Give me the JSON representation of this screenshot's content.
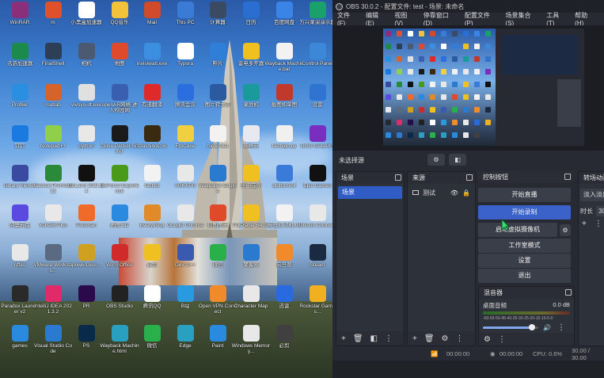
{
  "desktop_icons": [
    {
      "label": "WinRAR",
      "icon": "winrar-icon",
      "color": "#8b2f7a"
    },
    {
      "label": "m",
      "icon": "m-app-icon",
      "color": "#e0502a"
    },
    {
      "label": "小黑盒加速器",
      "icon": "xiaoheihe-icon",
      "color": "#ffffff"
    },
    {
      "label": "QQ音乐",
      "icon": "qqmusic-icon",
      "color": "#f2c23a"
    },
    {
      "label": "Mail",
      "icon": "mail-icon",
      "color": "#d04a2c"
    },
    {
      "label": "This PC",
      "icon": "this-pc-icon",
      "color": "#3a7bd5"
    },
    {
      "label": "计算器",
      "icon": "calculator-icon",
      "color": "#3b4a63"
    },
    {
      "label": "日历",
      "icon": "calendar-icon",
      "color": "#2b6ed2"
    },
    {
      "label": "百度网盘",
      "icon": "baidu-netdisk-icon",
      "color": "#3a84e8"
    },
    {
      "label": "万兴录演演示器",
      "icon": "wondershare-recorder-icon",
      "color": "#1aa06a"
    },
    {
      "label": "迅游加速器",
      "icon": "xunyou-icon",
      "color": "#1c8a4a"
    },
    {
      "label": "FinalShell",
      "icon": "finalshell-icon",
      "color": "#2d3e57"
    },
    {
      "label": "相机",
      "icon": "camera-icon",
      "color": "#4b5a70"
    },
    {
      "label": "地图",
      "icon": "maps-icon",
      "color": "#e04a2c"
    },
    {
      "label": "invisiwatt.exe",
      "icon": "invisiwatt-icon",
      "color": "#3b8ee0"
    },
    {
      "label": "Typora",
      "icon": "typora-icon",
      "color": "#ffffff"
    },
    {
      "label": "照片",
      "icon": "photos-icon",
      "color": "#2f7fd8"
    },
    {
      "label": "雷电多开器",
      "icon": "ldplayer-multi-icon",
      "color": "#f0c020"
    },
    {
      "label": "Wayback Machine.bat",
      "icon": "batch-file-icon",
      "color": "#f2f2f2"
    },
    {
      "label": "Control Panel",
      "icon": "control-panel-icon",
      "color": "#3c87d8"
    },
    {
      "label": "Profiler",
      "icon": "profiler-icon",
      "color": "#2a8fe0"
    },
    {
      "label": "matlab",
      "icon": "matlab-icon",
      "color": "#d6642a"
    },
    {
      "label": "vivoyo-dt.exe",
      "icon": "exe-file-icon",
      "color": "#e0e0e0"
    },
    {
      "label": "openAR网络 进入校园网",
      "icon": "openar-icon",
      "color": "#3a5fb0"
    },
    {
      "label": "有道翻译",
      "icon": "youdao-icon",
      "color": "#e02a2a"
    },
    {
      "label": "腾讯会议",
      "icon": "tencent-meeting-icon",
      "color": "#2a6ee0"
    },
    {
      "label": "图片转文字",
      "icon": "ocr-icon",
      "color": "#2c5aa0"
    },
    {
      "label": "录屏机",
      "icon": "screen-recorder-icon",
      "color": "#1a9a9a"
    },
    {
      "label": "截图和草图",
      "icon": "snip-sketch-icon",
      "color": "#c0392b"
    },
    {
      "label": "设置",
      "icon": "settings-gear-icon",
      "color": "#2f74d0"
    },
    {
      "label": "钉钉",
      "icon": "dingtalk-icon",
      "color": "#1a7ae0"
    },
    {
      "label": "Notepad++",
      "icon": "notepadpp-icon",
      "color": "#8fcf4a"
    },
    {
      "label": "python",
      "icon": "python-icon",
      "color": "#e8e8e8"
    },
    {
      "label": "Clone Packet Sniffer",
      "icon": "packet-sniffer-icon",
      "color": "#1a1a1a"
    },
    {
      "label": "ClashingCon",
      "icon": "clashingcon-icon",
      "color": "#3a2a10"
    },
    {
      "label": "FtpCaxe",
      "icon": "ftp-icon",
      "color": "#f0d040"
    },
    {
      "label": "meter.bat",
      "icon": "batch-file-icon",
      "color": "#f2f2f2"
    },
    {
      "label": "网络云",
      "icon": "cloud-app-icon",
      "color": "#e8e8f0"
    },
    {
      "label": "filethigh.py",
      "icon": "python-file-icon",
      "color": "#f0f0f0"
    },
    {
      "label": "GOG GALAXY",
      "icon": "gog-galaxy-icon",
      "color": "#7a2ec0"
    },
    {
      "label": "Binary Viewer",
      "icon": "binary-viewer-icon",
      "color": "#3a4aa0"
    },
    {
      "label": "Navicat Premium 12",
      "icon": "navicat-icon",
      "color": "#2a8a3a"
    },
    {
      "label": "GoLand 2021.3.4",
      "icon": "goland-icon",
      "color": "#111111"
    },
    {
      "label": "GeForce Experience",
      "icon": "geforce-icon",
      "color": "#4a9a1a"
    },
    {
      "label": "fastlist",
      "icon": "file-icon",
      "color": "#f2f2f2"
    },
    {
      "label": "ARKAPR",
      "icon": "arkapr-icon",
      "color": "#e8e8e8"
    },
    {
      "label": "Wallpaper Engine",
      "icon": "wallpaper-engine-icon",
      "color": "#2a7ad0"
    },
    {
      "label": "出门在外",
      "icon": "travel-icon",
      "color": "#f0c020"
    },
    {
      "label": "qbittorrent",
      "icon": "qbittorrent-icon",
      "color": "#3a7ad8"
    },
    {
      "label": "Epic Games",
      "icon": "epic-games-icon",
      "color": "#111111"
    },
    {
      "label": "阿里云盘",
      "icon": "aliyun-drive-icon",
      "color": "#5a4ae0"
    },
    {
      "label": "Xshell8 Plus",
      "icon": "xshell-icon",
      "color": "#e8e8e8"
    },
    {
      "label": "Postman",
      "icon": "postman-icon",
      "color": "#f06a2a"
    },
    {
      "label": "画图 3D",
      "icon": "paint3d-icon",
      "color": "#2a8ae0"
    },
    {
      "label": "Everything",
      "icon": "everything-icon",
      "color": "#e08a2a"
    },
    {
      "label": "Google Chrome",
      "icon": "chrome-icon",
      "color": "#e8e8e8"
    },
    {
      "label": "亿图图示",
      "icon": "edraw-icon",
      "color": "#e04a2a"
    },
    {
      "label": "PotPlayer 64 bit",
      "icon": "potplayer-icon",
      "color": "#f0c020"
    },
    {
      "label": "标签打印机.txt",
      "icon": "text-file-icon",
      "color": "#f2f2f2"
    },
    {
      "label": "Ubisoft Connect",
      "icon": "ubisoft-icon",
      "color": "#e8e8e8"
    },
    {
      "label": "gffas",
      "icon": "file-icon",
      "color": "#e8e8e8"
    },
    {
      "label": "VMware Workstati...",
      "icon": "vmware-icon",
      "color": "#5a6a80"
    },
    {
      "label": "powerDesi...",
      "icon": "powerdesigner-icon",
      "color": "#d0a020"
    },
    {
      "label": "WPS Office",
      "icon": "wps-icon",
      "color": "#d02a2a"
    },
    {
      "label": "必剪",
      "icon": "bijian-icon",
      "color": "#f0c020"
    },
    {
      "label": "Dev-C++",
      "icon": "devcpp-icon",
      "color": "#3a5ab0"
    },
    {
      "label": "微信",
      "icon": "wechat-icon",
      "color": "#2ab04a"
    },
    {
      "label": "聚客网",
      "icon": "jukewang-icon",
      "color": "#2a7ad0"
    },
    {
      "label": "向日葵",
      "icon": "sunlogin-icon",
      "color": "#f08a2a"
    },
    {
      "label": "Steam",
      "icon": "steam-icon",
      "color": "#1a2a40"
    },
    {
      "label": "Paradox Launcher v2",
      "icon": "paradox-icon",
      "color": "#2a2a2a"
    },
    {
      "label": "IntelliJ IDEA 2021.3.2",
      "icon": "intellij-icon",
      "color": "#e02a6a"
    },
    {
      "label": "PR",
      "icon": "premiere-icon",
      "color": "#2a0a4a"
    },
    {
      "label": "OBS Studio",
      "icon": "obs-icon",
      "color": "#222222"
    },
    {
      "label": "腾讯QQ",
      "icon": "qq-icon",
      "color": "#ffffff"
    },
    {
      "label": "B站",
      "icon": "bilibili-icon",
      "color": "#2a9ae0"
    },
    {
      "label": "Open VPN Connect",
      "icon": "openvpn-icon",
      "color": "#f08a2a"
    },
    {
      "label": "Character Map",
      "icon": "character-map-icon",
      "color": "#e8e8e8"
    },
    {
      "label": "迅雷",
      "icon": "xunlei-icon",
      "color": "#2a6ae0"
    },
    {
      "label": "Rockstar Games...",
      "icon": "rockstar-icon",
      "color": "#f0b020"
    },
    {
      "label": "games",
      "icon": "edge-folder-icon",
      "color": "#2a8ae0"
    },
    {
      "label": "Visual Studio Code",
      "icon": "vscode-icon",
      "color": "#2a7ad0"
    },
    {
      "label": "PS",
      "icon": "photoshop-icon",
      "color": "#0a2a4a"
    },
    {
      "label": "Wayback Machine.html",
      "icon": "edge-icon",
      "color": "#2aa0c0"
    },
    {
      "label": "微信",
      "icon": "wechat-icon",
      "color": "#2ab04a"
    },
    {
      "label": "Edge",
      "icon": "edge-icon",
      "color": "#2aa0c0"
    },
    {
      "label": "Paint",
      "icon": "paint-icon",
      "color": "#2a8ae0"
    },
    {
      "label": "Windows Memory...",
      "icon": "windows-memory-icon",
      "color": "#e8e8e8"
    },
    {
      "label": "必剪",
      "icon": "bijian-icon",
      "color": "#404040"
    }
  ],
  "obs": {
    "window_title": "OBS 30.0.2 - 配置文件: test - 场景: 未命名",
    "menu": [
      "文件(F)",
      "编辑(E)",
      "视图(V)",
      "停靠窗口(D)",
      "配置文件(P)",
      "场景集合(S)",
      "工具(T)",
      "帮助(H)"
    ],
    "no_source_selected": "未选择源",
    "scenes": {
      "title": "场景",
      "items": [
        "场景"
      ]
    },
    "sources": {
      "title": "来源",
      "items": [
        {
          "label": "测试",
          "icon": "monitor-icon"
        }
      ]
    },
    "controls": {
      "title": "控制按钮",
      "buttons": [
        "开始直播",
        "开始录制",
        "启动虚拟摄像机",
        "工作室模式",
        "设置",
        "退出"
      ],
      "active_index": 1
    },
    "mixer": {
      "title": "混音器",
      "track": "桌面音频",
      "level": "0.0 dB",
      "meter_ticks": "-60-55-50-45-40-35-30-25-20-15-10-5-0",
      "volume": 0.88
    },
    "transitions": {
      "title": "转场动画",
      "fade": "淡入淡出",
      "duration_label": "时长",
      "duration_value": "300"
    },
    "status": {
      "rec_time1": "00:00:00",
      "rec_time2": "00:00:00",
      "cpu": "CPU: 0.6%",
      "fps": "30.00 / 30.00"
    }
  }
}
